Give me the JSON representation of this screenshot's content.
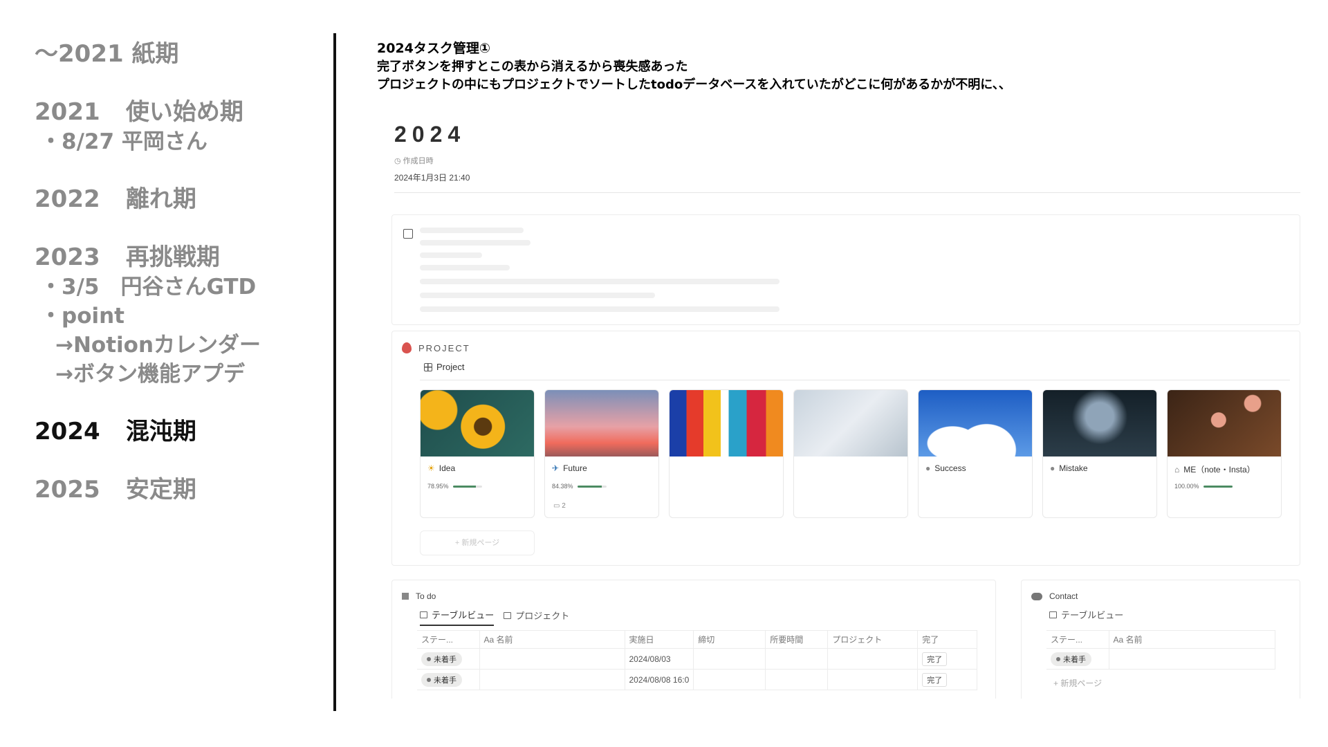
{
  "timeline": {
    "era0": {
      "year": "〜2021",
      "label": "紙期"
    },
    "era1": {
      "year": "2021",
      "label": "使い始め期",
      "subs": [
        "・8/27 平岡さん"
      ]
    },
    "era2": {
      "year": "2022",
      "label": "離れ期"
    },
    "era3": {
      "year": "2023",
      "label": "再挑戦期",
      "subs": [
        "・3/5　円谷さんGTD",
        "・point",
        "→Notionカレンダー",
        "→ボタン機能アプデ"
      ]
    },
    "era4": {
      "year": "2024",
      "label": "混沌期"
    },
    "era5": {
      "year": "2025",
      "label": "安定期"
    }
  },
  "notes": {
    "title": "2024タスク管理①",
    "line1": "完了ボタンを押すとこの表から消えるから喪失感あった",
    "line2": "プロジェクトの中にもプロジェクトでソートしたtodoデータベースを入れていたがどこに何があるかが不明に、、"
  },
  "page": {
    "title": "2024",
    "created_label": "作成日時",
    "created_value": "2024年1月3日 21:40"
  },
  "project": {
    "heading": "PROJECT",
    "view_tab": "Project",
    "new_page": "+ 新規ページ",
    "cards": [
      {
        "name": "Idea",
        "pct": "78.95%",
        "progress": 0.7895,
        "icon": "☀"
      },
      {
        "name": "Future",
        "pct": "84.38%",
        "progress": 0.8438,
        "icon": "✈",
        "comments": "2"
      },
      {
        "name": "",
        "pct": "",
        "progress": 0
      },
      {
        "name": "",
        "pct": "",
        "progress": 0
      },
      {
        "name": "Success",
        "pct": "",
        "progress": 0,
        "icon": "●"
      },
      {
        "name": "Mistake",
        "pct": "",
        "progress": 0,
        "icon": "●"
      },
      {
        "name": "ME（note・Insta）",
        "pct": "100.00%",
        "progress": 1.0,
        "icon": "⌂"
      }
    ]
  },
  "todo_db": {
    "title": "To do",
    "tabs": [
      "テーブルビュー",
      "プロジェクト"
    ],
    "columns": [
      "ステー...",
      "Aa 名前",
      "実施日",
      "締切",
      "所要時間",
      "プロジェクト",
      "完了"
    ],
    "rows": [
      {
        "status": "未着手",
        "date": "2024/08/03",
        "done": "完了"
      },
      {
        "status": "未着手",
        "date": "2024/08/08 16:0",
        "done": "完了"
      }
    ]
  },
  "contact_db": {
    "title": "Contact",
    "tab": "テーブルビュー",
    "columns": [
      "ステー...",
      "Aa 名前"
    ],
    "rows": [
      {
        "status": "未着手"
      }
    ],
    "new_page": "+ 新規ページ"
  }
}
